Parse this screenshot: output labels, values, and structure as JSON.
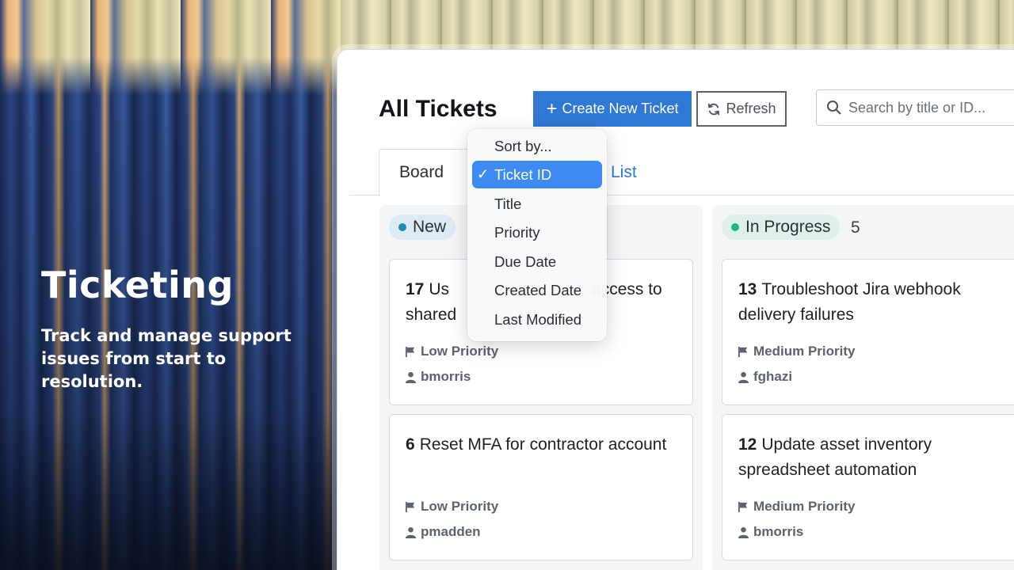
{
  "hero": {
    "title": "Ticketing",
    "subtitle": "Track and manage support issues from start to resolution."
  },
  "header": {
    "title": "All Tickets",
    "create_label": "Create New Ticket",
    "refresh_label": "Refresh",
    "search_placeholder": "Search by title or ID..."
  },
  "tabs": {
    "board": "Board",
    "list": "List"
  },
  "sort_menu": {
    "header": "Sort by...",
    "options": [
      "Ticket ID",
      "Title",
      "Priority",
      "Due Date",
      "Created Date",
      "Last Modified"
    ],
    "selected": "Ticket ID"
  },
  "columns": [
    {
      "status": "New",
      "count": "",
      "color": "#1e8bb0",
      "cards": [
        {
          "id": "17",
          "title_line1": "Us",
          "title_line1_end": "access to",
          "title_line2": "shared",
          "priority": "Low Priority",
          "assignee": "bmorris"
        },
        {
          "id": "6",
          "title": "Reset MFA for contractor account",
          "priority": "Low Priority",
          "assignee": "pmadden"
        }
      ]
    },
    {
      "status": "In Progress",
      "count": "5",
      "color": "#21b38a",
      "cards": [
        {
          "id": "13",
          "title": "Troubleshoot Jira webhook delivery failures",
          "priority": "Medium Priority",
          "assignee": "fghazi"
        },
        {
          "id": "12",
          "title": "Update asset inventory spreadsheet automation",
          "priority": "Medium Priority",
          "assignee": "bmorris"
        }
      ]
    }
  ],
  "colors": {
    "accent": "#2f78d6",
    "selected": "#3d8bf2"
  }
}
